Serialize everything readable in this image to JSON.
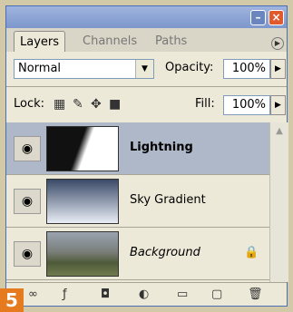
{
  "tabs": {
    "layers": "Layers",
    "channels": "Channels",
    "paths": "Paths"
  },
  "blend_mode": "Normal",
  "opacity": {
    "label": "Opacity:",
    "value": "100%"
  },
  "lock": {
    "label": "Lock:"
  },
  "fill": {
    "label": "Fill:",
    "value": "100%"
  },
  "layers": [
    {
      "name": "Lightning",
      "selected": true
    },
    {
      "name": "Sky Gradient",
      "selected": false
    },
    {
      "name": "Background",
      "selected": false,
      "locked": true
    }
  ],
  "step_badge": "5"
}
